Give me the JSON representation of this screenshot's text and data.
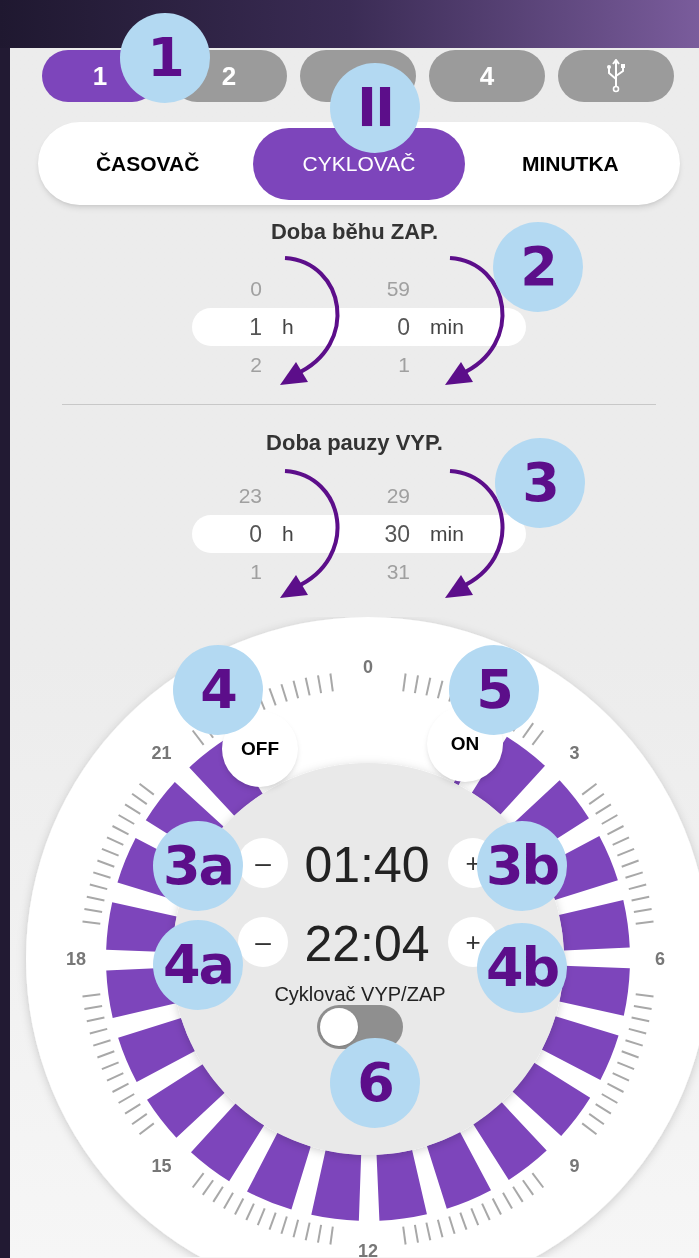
{
  "channel_tabs": [
    {
      "kind": "number",
      "label": "1",
      "selected": true
    },
    {
      "kind": "number",
      "label": "2",
      "selected": false
    },
    {
      "kind": "blank",
      "selected": false
    },
    {
      "kind": "number",
      "label": "4",
      "selected": false
    },
    {
      "kind": "usb",
      "selected": false
    }
  ],
  "mode_tabs": [
    {
      "label": "ČASOVAČ",
      "selected": false
    },
    {
      "label": "CYKLOVAČ",
      "selected": true
    },
    {
      "label": "MINUTKA",
      "selected": false
    }
  ],
  "pickers": [
    {
      "title": "Doba běhu ZAP.",
      "hours": {
        "above": "0",
        "value": "1",
        "below": "2",
        "unit": "h"
      },
      "minutes": {
        "above": "59",
        "value": "0",
        "below": "1",
        "unit": "min"
      }
    },
    {
      "title": "Doba pauzy VYP.",
      "hours": {
        "above": "23",
        "value": "0",
        "below": "1",
        "unit": "h"
      },
      "minutes": {
        "above": "29",
        "value": "30",
        "below": "31",
        "unit": "min"
      }
    }
  ],
  "dial": {
    "hour_labels": [
      "0",
      "3",
      "6",
      "9",
      "12",
      "15",
      "18",
      "21"
    ],
    "off_button": "OFF",
    "on_button": "ON",
    "times": [
      {
        "minus": "–",
        "value": "01:40",
        "plus": "+"
      },
      {
        "minus": "–",
        "value": "22:04",
        "plus": "+"
      }
    ],
    "switch_label": "Cyklovač VYP/ZAP",
    "switch_on": false
  },
  "annotations": [
    {
      "label": "1"
    },
    {
      "label": "II"
    },
    {
      "label": "2"
    },
    {
      "label": "3"
    },
    {
      "label": "4"
    },
    {
      "label": "5"
    },
    {
      "label": "3a"
    },
    {
      "label": "3b"
    },
    {
      "label": "4a"
    },
    {
      "label": "4b"
    },
    {
      "label": "6"
    }
  ]
}
